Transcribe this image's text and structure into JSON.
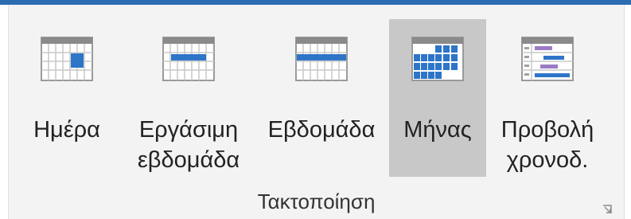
{
  "ribbon_group": {
    "title": "Τακτοποίηση",
    "buttons": [
      {
        "label": "Ημέρα",
        "icon": "day-view-icon",
        "selected": false
      },
      {
        "label": "Εργάσιμη\nεβδομάδα",
        "icon": "work-week-view-icon",
        "selected": false
      },
      {
        "label": "Εβδομάδα",
        "icon": "week-view-icon",
        "selected": false
      },
      {
        "label": "Μήνας",
        "icon": "month-view-icon",
        "selected": true
      },
      {
        "label": "Προβολή\nχρονοδ.",
        "icon": "schedule-view-icon",
        "selected": false
      }
    ],
    "launcher_icon": "dialog-launcher-icon"
  },
  "colors": {
    "accent_blue": "#2b6cb0",
    "icon_blue": "#2e75c8",
    "icon_gray": "#8a8a8a",
    "icon_purple": "#9b7cc4",
    "selected_bg": "#c8c8c8"
  }
}
